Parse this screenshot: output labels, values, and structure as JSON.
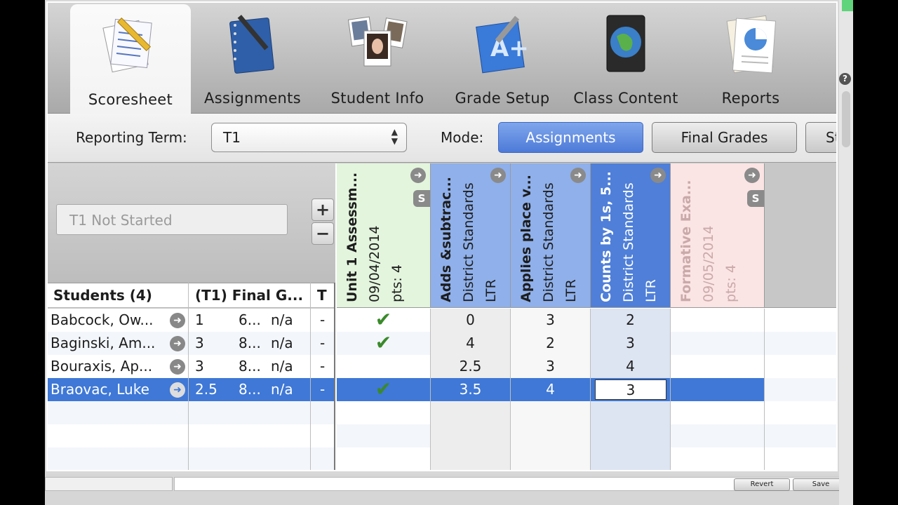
{
  "toolbar": {
    "items": [
      {
        "label": "Scoresheet",
        "icon": "scoresheet-icon",
        "active": true
      },
      {
        "label": "Assignments",
        "icon": "notebook-icon",
        "active": false
      },
      {
        "label": "Student Info",
        "icon": "student-photos-icon",
        "active": false
      },
      {
        "label": "Grade Setup",
        "icon": "grade-setup-icon",
        "active": false
      },
      {
        "label": "Class Content",
        "icon": "globe-book-icon",
        "active": false
      },
      {
        "label": "Reports",
        "icon": "reports-icon",
        "active": false
      }
    ]
  },
  "term": {
    "label": "Reporting Term:",
    "value": "T1"
  },
  "mode": {
    "label": "Mode:",
    "options": [
      "Assignments",
      "Final Grades",
      "St"
    ],
    "selected": "Assignments"
  },
  "left": {
    "status": "T1 Not Started",
    "plus": "+",
    "minus": "−",
    "headers": {
      "students": "Students (4)",
      "final": "(T1)  Final G...",
      "t": "T"
    }
  },
  "students": [
    {
      "name": "Babcock, Ow...",
      "grade": "1",
      "pct": "6...",
      "na": "n/a",
      "t": "-"
    },
    {
      "name": "Baginski, Am...",
      "grade": "3",
      "pct": "8...",
      "na": "n/a",
      "t": "-"
    },
    {
      "name": "Bouraxis, Ap...",
      "grade": "3",
      "pct": "8...",
      "na": "n/a",
      "t": "-"
    },
    {
      "name": "Braovac, Luke",
      "grade": "2.5",
      "pct": "8...",
      "na": "n/a",
      "t": "-",
      "selected": true
    }
  ],
  "assignments": [
    {
      "title": "Unit 1 Assessm...",
      "line2": "09/04/2014",
      "line3": "pts: 4",
      "color": "#e3f5dd",
      "badge": "S"
    },
    {
      "title": "Adds &subtrac...",
      "line2": "District Standards",
      "line3": "LTR",
      "color": "#8fb0ea"
    },
    {
      "title": "Applies place v...",
      "line2": "District Standards",
      "line3": "LTR",
      "color": "#8fb0ea"
    },
    {
      "title": "Counts by 1s, 5...",
      "line2": "District Standards",
      "line3": "LTR",
      "color": "#4f7fd8"
    },
    {
      "title": "Formative Exa...",
      "line2": "09/05/2014",
      "line3": "pts: 4",
      "color": "#fbe4e4",
      "badge": "S"
    }
  ],
  "scores": [
    [
      "check",
      "0",
      "3",
      "2",
      ""
    ],
    [
      "check",
      "4",
      "2",
      "3",
      ""
    ],
    [
      "",
      "2.5",
      "3",
      "4",
      ""
    ],
    [
      "check",
      "3.5",
      "4",
      "3",
      ""
    ]
  ],
  "footer": {
    "revert": "Revert",
    "save": "Save"
  }
}
